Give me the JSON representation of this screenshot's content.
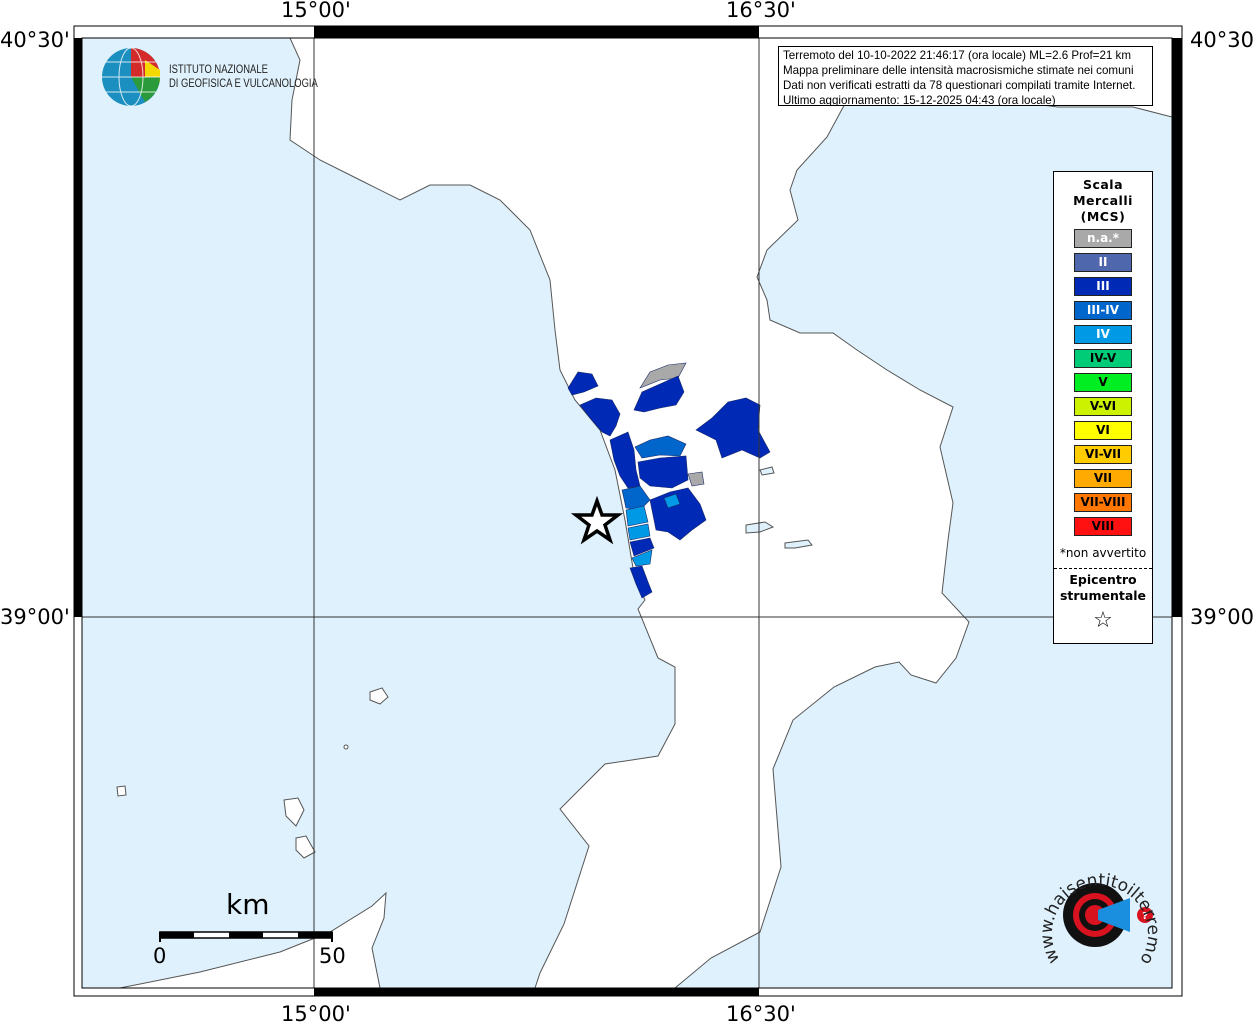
{
  "map": {
    "colors": {
      "sea": "#dff1fc",
      "land": "#ffffff",
      "coast": "#555555",
      "frame": "#000000"
    },
    "ticks": {
      "lon": [
        "15°00'",
        "16°30'"
      ],
      "lat": [
        "40°30'",
        "39°00'"
      ]
    },
    "info": {
      "line1": "Terremoto del 10-10-2022 21:46:17 (ora locale) ML=2.6 Prof=21 km",
      "line2": "Mappa preliminare delle intensità macrosismiche stimate nei comuni",
      "line3": "Dati non verificati estratti da 78 questionari compilati tramite Internet.",
      "line4": "Ultimo aggiornamento: 15-12-2025 04:43 (ora locale)"
    },
    "ingv_logo": {
      "line1": "ISTITUTO NAZIONALE",
      "line2": "DI GEOFISICA E VULCANOLOGIA"
    },
    "hst_logo": {
      "text": "www.haisentitoilterremoto.it"
    },
    "scale_bar": {
      "unit": "km",
      "start": "0",
      "end": "50"
    },
    "epicenter_icon": "star-outline-icon"
  },
  "legend": {
    "title1": "Scala",
    "title2": "Mercalli",
    "title3": "(MCS)",
    "items": [
      {
        "label": "n.a.*",
        "color": "#a9a9a9",
        "text": "#ffffff"
      },
      {
        "label": "II",
        "color": "#4f67ad",
        "text": "#ffffff"
      },
      {
        "label": "III",
        "color": "#0029b5",
        "text": "#ffffff"
      },
      {
        "label": "III-IV",
        "color": "#0066cc",
        "text": "#ffffff"
      },
      {
        "label": "IV",
        "color": "#0099e6",
        "text": "#ffffff"
      },
      {
        "label": "IV-V",
        "color": "#00cc77",
        "text": "#000000"
      },
      {
        "label": "V",
        "color": "#00ee22",
        "text": "#000000"
      },
      {
        "label": "V-VI",
        "color": "#ccf200",
        "text": "#000000"
      },
      {
        "label": "VI",
        "color": "#ffff00",
        "text": "#000000"
      },
      {
        "label": "VI-VII",
        "color": "#ffcc00",
        "text": "#000000"
      },
      {
        "label": "VII",
        "color": "#ffaa00",
        "text": "#000000"
      },
      {
        "label": "VII-VIII",
        "color": "#ff7700",
        "text": "#000000"
      },
      {
        "label": "VIII",
        "color": "#ff1111",
        "text": "#000000"
      }
    ],
    "note": "*non avvertito",
    "epicenter1": "Epicentro",
    "epicenter2": "strumentale",
    "epicenter_symbol": "☆"
  }
}
